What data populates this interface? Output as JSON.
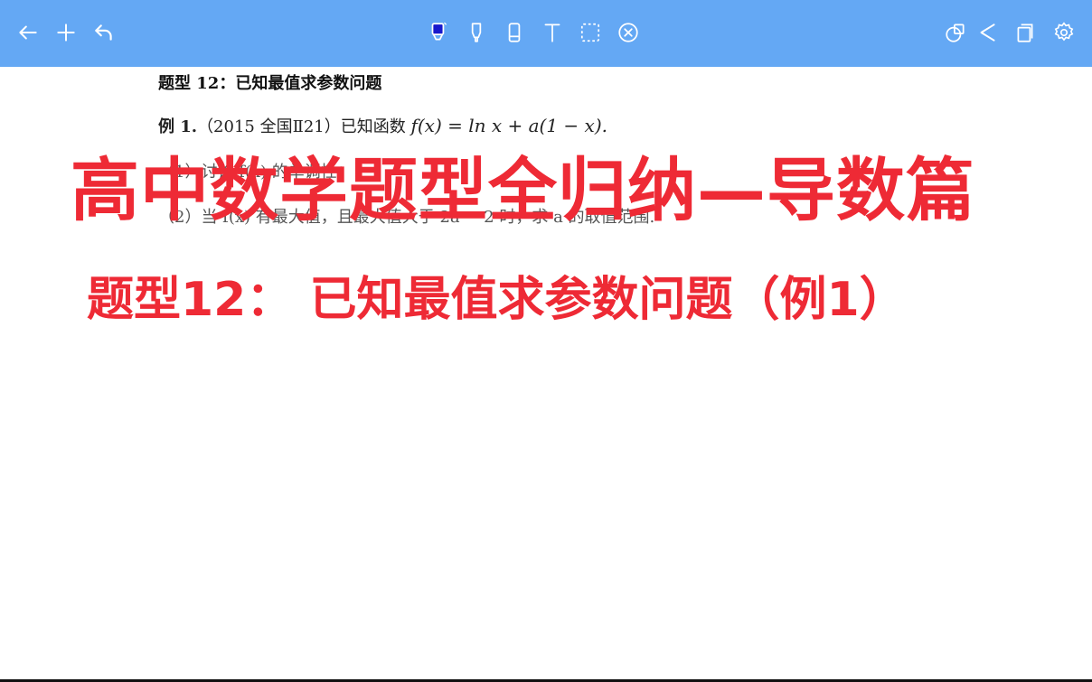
{
  "toolbar": {
    "left_tools": [
      "back-arrow-icon",
      "plus-icon",
      "undo-icon"
    ],
    "center_tools": [
      "pen-icon",
      "highlighter-icon",
      "eraser-icon",
      "text-icon",
      "lasso-select-icon",
      "laser-pointer-icon"
    ],
    "right_tools": [
      "shapes-icon",
      "share-icon",
      "copy-page-icon",
      "settings-icon"
    ],
    "active_tool_color": "#1818cc"
  },
  "document": {
    "heading": "题型 12：已知最值求参数问题",
    "example_label": "例 1.",
    "example_source": "（2015 全国Ⅱ21）已知函数",
    "function_expr": "f(x) = ln x + a(1 − x).",
    "part1": "（1）讨论 f(x) 的单调性；",
    "part2": "（2）当 f(x) 有最大值，且最大值大于 2a − 2 时，求 a 的取值范围."
  },
  "overlay": {
    "title": "高中数学题型全归纳—导数篇",
    "subtitle": "题型12：  已知最值求参数问题（例1）",
    "color": "#ee2a35"
  }
}
